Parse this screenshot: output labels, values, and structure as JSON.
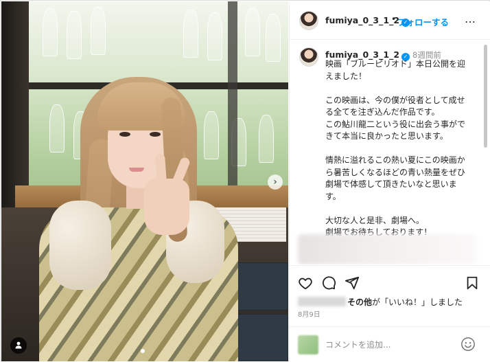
{
  "post": {
    "username": "fumiya_0_3_1_2",
    "follow_label": "フォローする",
    "separator": "•",
    "more_label": "…"
  },
  "caption": {
    "username": "fumiya_0_3_1_2",
    "time_ago": "8週間前",
    "paragraphs": [
      [
        "映画「ブルーピリオド」本日公開を迎",
        "えました！"
      ],
      [
        "この映画は、今の僕が役者として成せ",
        "る全てを注ぎ込んだ作品です。",
        "この鮎川龍二という役に出会う事がで",
        "きて本当に良かったと思います。"
      ],
      [
        "情熱に溢れるこの熱い夏にこの映画か",
        "ら暑苦しくなるほどの青い熱量をぜひ",
        "劇場で体感して頂きたいなと思いま",
        "す。"
      ],
      [
        "大切な人と是非、劇場へ。",
        "劇場でお待ちしております！"
      ]
    ]
  },
  "likes": {
    "others_label": "その他",
    "suffix": "が「いいね！」しました"
  },
  "date": "8月9日",
  "comment": {
    "placeholder": "コメントを追加..."
  },
  "icons": [
    "heart-icon",
    "comment-icon",
    "share-icon",
    "bookmark-icon",
    "emoji-icon",
    "tag-user-icon",
    "next-arrow-icon",
    "more-icon"
  ]
}
